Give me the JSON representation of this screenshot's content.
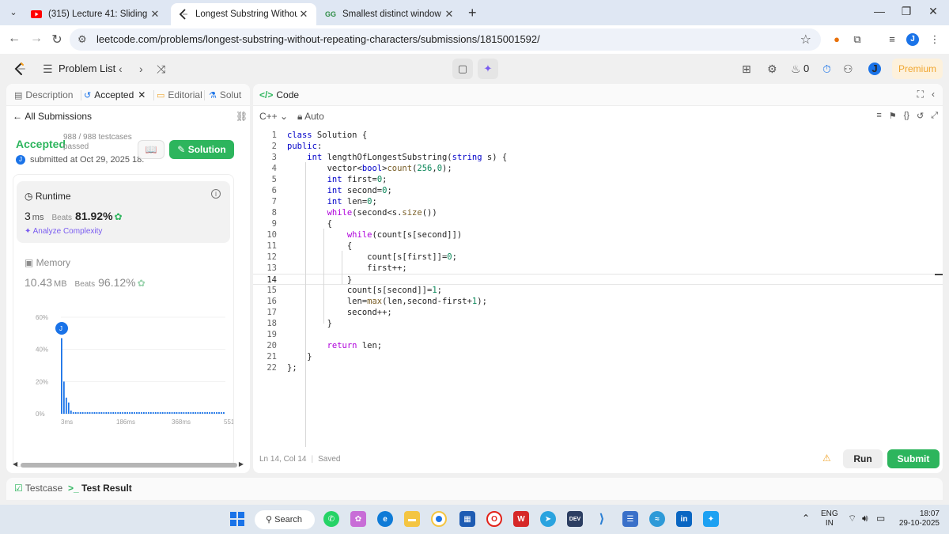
{
  "browser": {
    "tabs": [
      {
        "title": "(315) Lecture 41: Sliding Windo",
        "icon": "youtube-icon",
        "active": false
      },
      {
        "title": "Longest Substring Without Rep",
        "icon": "leetcode-icon",
        "active": true
      },
      {
        "title": "Smallest distinct window | Pract",
        "icon": "geeksforgeeks-icon",
        "active": false
      }
    ],
    "close_glyph": "✕",
    "url": "leetcode.com/problems/longest-substring-without-repeating-characters/submissions/1815001592/",
    "profile_initial": "J"
  },
  "nav": {
    "problem_list": "Problem List",
    "streak_count": "0",
    "user_initial": "J",
    "premium": "Premium"
  },
  "left": {
    "tabs": {
      "description": "Description",
      "accepted": "Accepted",
      "editorial": "Editorial",
      "solutions": "Solut"
    },
    "all_submissions": "All Submissions",
    "status": "Accepted",
    "testcases_line1": "988 / 988 testcases",
    "testcases_line2": "passed",
    "submitted_by_initial": "J",
    "submitted_at": "submitted at Oct 29, 2025 18:",
    "solution_button": "Solution",
    "runtime": {
      "title": "Runtime",
      "value": "3",
      "unit": "ms",
      "beats_label": "Beats",
      "beats_pct": "81.92%",
      "analyze": "Analyze Complexity"
    },
    "memory": {
      "title": "Memory",
      "value": "10.43",
      "unit": "MB",
      "beats_label": "Beats",
      "beats_pct": "96.12%"
    }
  },
  "chart_data": {
    "type": "bar",
    "ylabel_ticks": [
      "60%",
      "40%",
      "20%",
      "0%"
    ],
    "ylim": [
      0,
      60
    ],
    "xticks": [
      "3ms",
      "186ms",
      "368ms",
      "551ms"
    ],
    "marker_label": "J",
    "marker_at": "3ms",
    "values": [
      47,
      20,
      10,
      7,
      2,
      1,
      1,
      1,
      1,
      1,
      1,
      1,
      1,
      1,
      1,
      1,
      1,
      1,
      1,
      1,
      1,
      1,
      1,
      1,
      1,
      1,
      1,
      1,
      1,
      1,
      1,
      1,
      1,
      1,
      1,
      1,
      1,
      1,
      1,
      1,
      1,
      1,
      1,
      1,
      1,
      1,
      1,
      1,
      1,
      1,
      1,
      1,
      1,
      1,
      1,
      1,
      1,
      1,
      1,
      1,
      1,
      1,
      1,
      1,
      1,
      1,
      1,
      1,
      1,
      1
    ]
  },
  "code": {
    "title": "Code",
    "language": "C++",
    "mode": "Auto",
    "lines": [
      {
        "n": "1",
        "html": "<span class='kw'>class</span> Solution {"
      },
      {
        "n": "2",
        "html": "<span class='kw'>public</span>:"
      },
      {
        "n": "3",
        "html": "    <span class='kw'>int</span> lengthOfLongestSubstring(<span class='kw'>string</span> s) {"
      },
      {
        "n": "4",
        "html": "        vector&lt;<span class='kw'>bool</span>&gt;<span class='fn'>count</span>(<span class='num'>256</span>,<span class='num'>0</span>);"
      },
      {
        "n": "5",
        "html": "        <span class='kw'>int</span> first=<span class='num'>0</span>;"
      },
      {
        "n": "6",
        "html": "        <span class='kw'>int</span> second=<span class='num'>0</span>;"
      },
      {
        "n": "7",
        "html": "        <span class='kw'>int</span> len=<span class='num'>0</span>;"
      },
      {
        "n": "8",
        "html": "        <span class='kw2'>while</span>(second&lt;s.<span class='fn'>size</span>())"
      },
      {
        "n": "9",
        "html": "        {"
      },
      {
        "n": "10",
        "html": "            <span class='kw2'>while</span>(count[s[second]])"
      },
      {
        "n": "11",
        "html": "            {"
      },
      {
        "n": "12",
        "html": "                count[s[first]]=<span class='num'>0</span>;"
      },
      {
        "n": "13",
        "html": "                first++;"
      },
      {
        "n": "14",
        "html": "            }"
      },
      {
        "n": "15",
        "html": "            count[s[second]]=<span class='num'>1</span>;"
      },
      {
        "n": "16",
        "html": "            len=<span class='fn'>max</span>(len,second-first+<span class='num'>1</span>);"
      },
      {
        "n": "17",
        "html": "            second++;"
      },
      {
        "n": "18",
        "html": "        }"
      },
      {
        "n": "19",
        "html": ""
      },
      {
        "n": "20",
        "html": "        <span class='kw2'>return</span> len;"
      },
      {
        "n": "21",
        "html": "    }"
      },
      {
        "n": "22",
        "html": "};"
      }
    ],
    "current_line": "14",
    "status_pos": "Ln 14, Col 14",
    "status_saved": "Saved",
    "run": "Run",
    "submit": "Submit"
  },
  "bottom": {
    "testcase": "Testcase",
    "test_result": "Test Result"
  },
  "taskbar": {
    "search": "Search",
    "lang_line1": "ENG",
    "lang_line2": "IN",
    "time": "18:07",
    "date": "29-10-2025"
  }
}
